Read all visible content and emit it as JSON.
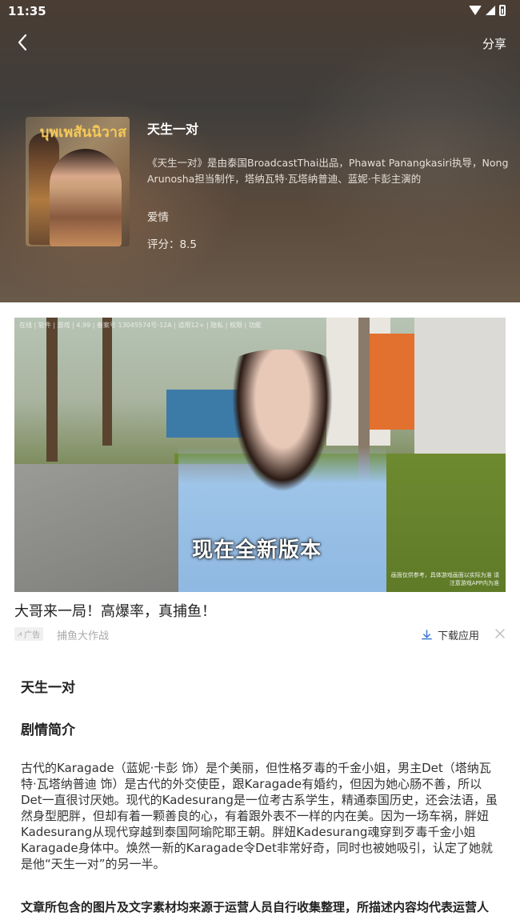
{
  "status_bar": {
    "time": "11:35"
  },
  "header": {
    "share_label": "分享"
  },
  "drama": {
    "title": "天生一对",
    "poster_title": "บุพเพสันนิวาส",
    "description": "《天生一对》是由泰国BroadcastThai出品，Phawat Panangkasiri执导，Nong Arunosha担当制作，塔纳瓦特·瓦塔纳普迪、蓝妮·卡彭主演的",
    "genre": "爱情",
    "rating": "评分：8.5"
  },
  "ad": {
    "image_caption": "现在全新版本",
    "image_top_meta": "在线 | 软件 | 游戏 | 4.99 | 备案号 13045574号-12A | 适用12+ | 隐私 | 权限 | 功能",
    "image_notice": "画面仅供参考，具体游戏画面以实际为准 请注意游戏APP内为准",
    "title": "大哥来一局！高爆率，真捕鱼！",
    "badge_label": "广告",
    "source": "捕鱼大作战",
    "download_label": "下载应用"
  },
  "article": {
    "heading": "天生一对",
    "section_title": "剧情简介",
    "synopsis": "古代的Karagade（蓝妮·卡彭 饰）是个美丽，但性格歹毒的千金小姐，男主Det（塔纳瓦特·瓦塔纳普迪 饰）是古代的外交使臣，跟Karagade有婚约，但因为她心肠不善，所以Det一直很讨厌她。现代的Kadesurang是一位考古系学生，精通泰国历史，还会法语，虽然身型肥胖，但却有着一颗善良的心，有着跟外表不一样的内在美。因为一场车祸，胖妞Kadesurang从现代穿越到泰国阿瑜陀耶王朝。胖妞Kadesurang魂穿到歹毒千金小姐Karagade身体中。焕然一新的Karagade令Det非常好奇，同时也被她吸引，认定了她就是他“天生一对”的另一半。",
    "disclaimer": "文章所包含的图片及文字素材均来源于运营人员自行收集整理，所描述内容均代表运营人"
  }
}
